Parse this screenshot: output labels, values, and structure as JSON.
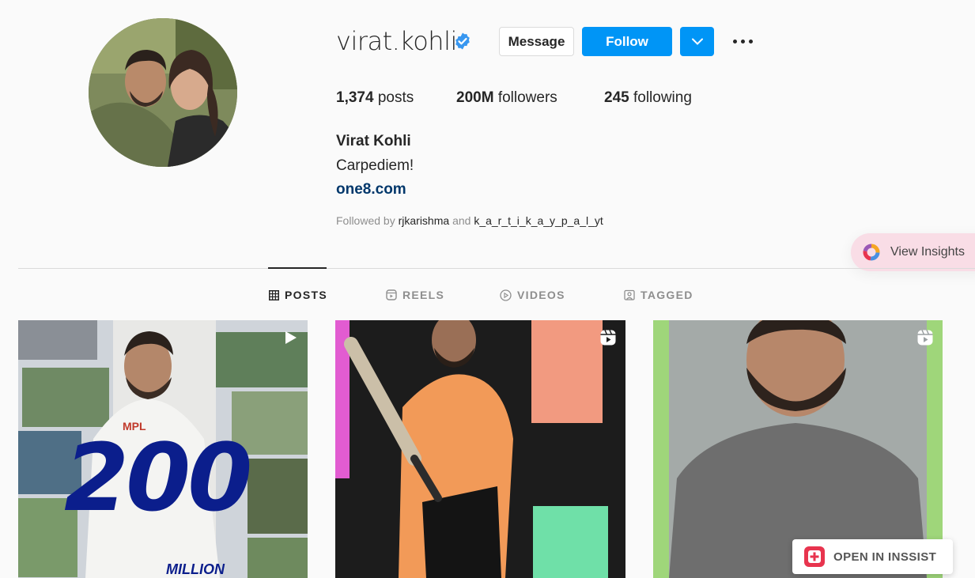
{
  "profile": {
    "username": "virat.kohli",
    "verified": true,
    "full_name": "Virat Kohli",
    "bio": "Carpediem!",
    "link": "one8.com",
    "followed_by_prefix": "Followed by",
    "followed_by_user1": "rjkarishma",
    "followed_by_and": "and",
    "followed_by_user2": "k_a_r_t_i_k_a_y_p_a_l_yt"
  },
  "actions": {
    "message_label": "Message",
    "follow_label": "Follow"
  },
  "stats": {
    "posts_count": "1,374",
    "posts_label": "posts",
    "followers_count": "200M",
    "followers_label": "followers",
    "following_count": "245",
    "following_label": "following"
  },
  "insights": {
    "label": "View Insights"
  },
  "tabs": [
    {
      "label": "POSTS",
      "icon": "grid-icon",
      "active": true
    },
    {
      "label": "REELS",
      "icon": "reels-icon",
      "active": false
    },
    {
      "label": "VIDEOS",
      "icon": "play-circle-icon",
      "active": false
    },
    {
      "label": "TAGGED",
      "icon": "tag-icon",
      "active": false
    }
  ],
  "posts": [
    {
      "type": "video",
      "overlay_text": "200",
      "overlay_subtext": "MILLION",
      "jersey_text": "MPL"
    },
    {
      "type": "reel"
    },
    {
      "type": "reel"
    }
  ],
  "inssist": {
    "label": "OPEN IN INSSIST"
  },
  "colors": {
    "follow_blue": "#0095f6",
    "link_color": "#00376b",
    "verified_blue": "#3897f0",
    "insights_bg": "#f9dde6",
    "inssist_red": "#e8344e"
  }
}
